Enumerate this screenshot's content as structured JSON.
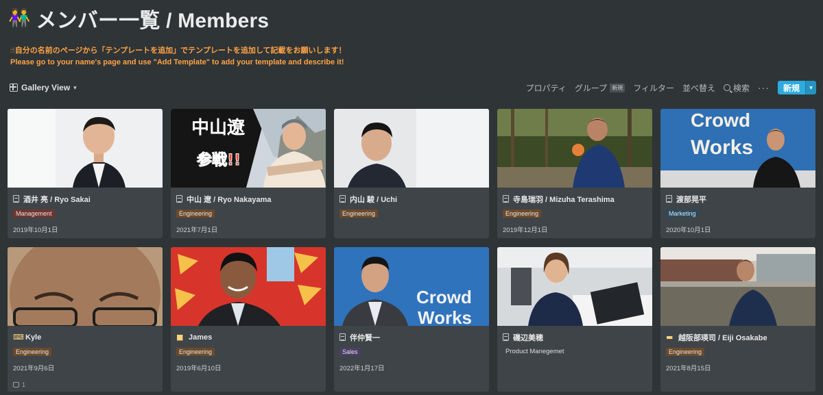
{
  "header": {
    "emoji": "👫",
    "title": "メンバー一覧 / Members"
  },
  "callout": {
    "line1": "☝自分の名前のページから「テンプレートを追加」でテンプレートを追加して記載をお願いします！",
    "line2": "Please go to your name's page and use \"Add Template\" to add your template and describe it!"
  },
  "toolbar": {
    "view_label": "Gallery View",
    "properties": "プロパティ",
    "group": "グループ",
    "group_badge": "新規",
    "filter": "フィルター",
    "sort": "並べ替え",
    "search": "検索",
    "more": "···",
    "new_label": "新規"
  },
  "cards": [
    {
      "icon": "page-icon",
      "name": "酒井 亮 / Ryo Sakai",
      "tag": "Management",
      "date": "2019年10月1日"
    },
    {
      "icon": "page-icon",
      "name": "中山 遼 / Ryo Nakayama",
      "tag": "Engineering",
      "date": "2021年7月1日",
      "cover_text_1": "中山遼",
      "cover_text_2": "参戦!!"
    },
    {
      "icon": "page-icon",
      "name": "内山 駿 / Uchi",
      "tag": "Engineering",
      "date": ""
    },
    {
      "icon": "page-icon",
      "name": "寺島瑞羽 / Mizuha Terashima",
      "tag": "Engineering",
      "date": "2019年12月1日"
    },
    {
      "icon": "page-icon",
      "name": "渡部晃平",
      "tag": "Marketing",
      "date": "2020年10月1日",
      "cover_text_1": "Crowd",
      "cover_text_2": "Works"
    },
    {
      "icon": "keyboard-icon",
      "icon_glyph": "⌨",
      "name": "Kyle",
      "tag": "Engineering",
      "date": "2021年9月6日",
      "comments": "1"
    },
    {
      "icon": "box-icon",
      "icon_glyph": "■",
      "name": "James",
      "tag": "Engineering",
      "date": "2019年6月10日"
    },
    {
      "icon": "page-icon",
      "name": "伴仲賢一",
      "tag": "Sales",
      "date": "2022年1月17日",
      "cover_text_1": "Crowd",
      "cover_text_2": "Works"
    },
    {
      "icon": "page-icon",
      "name": "磯辺美穂",
      "prop": "Product Manegemet"
    },
    {
      "icon": "laptop-icon",
      "icon_glyph": "▬",
      "name": "越阪部瑛司 / Eiji Osakabe",
      "tag": "Engineering",
      "date": "2021年8月15日"
    }
  ]
}
